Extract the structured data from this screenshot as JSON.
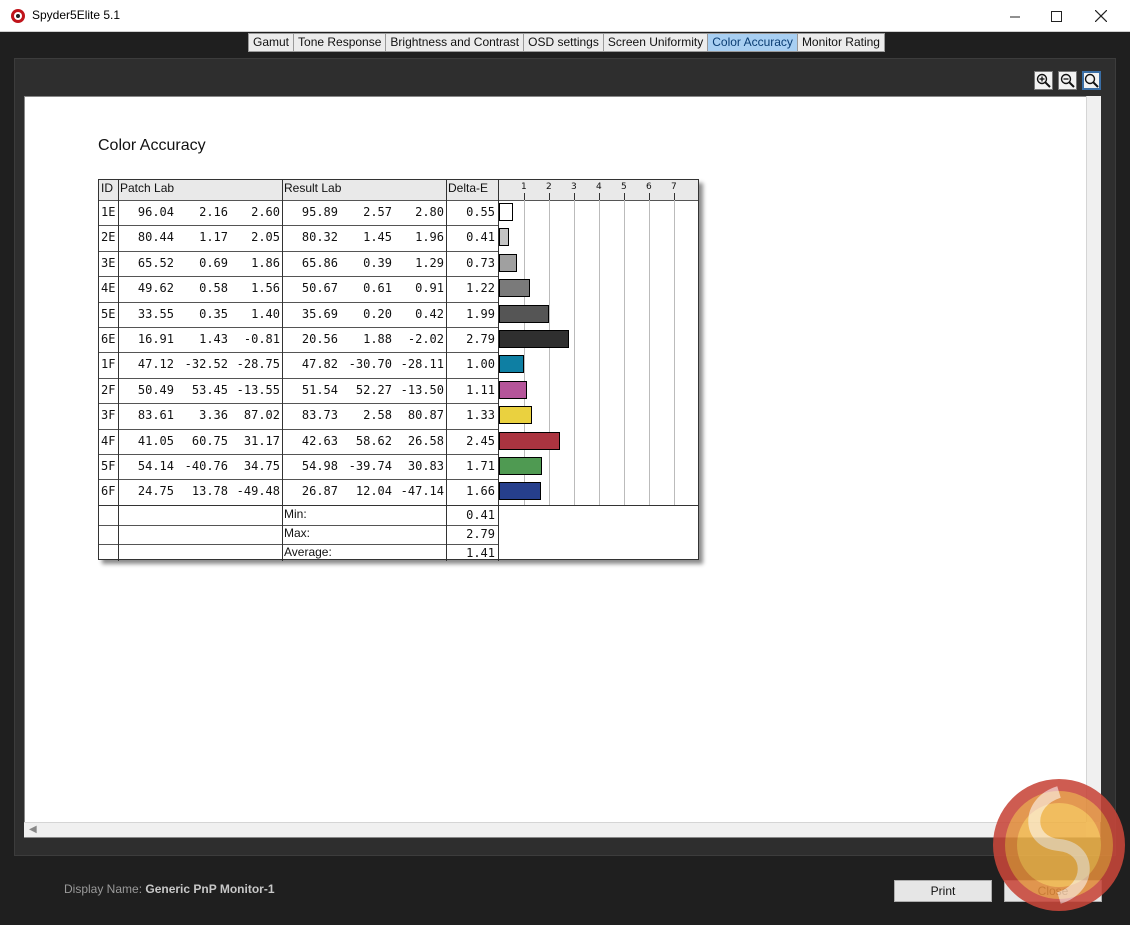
{
  "window": {
    "title": "Spyder5Elite 5.1"
  },
  "tabs": [
    {
      "label": "Gamut",
      "active": false
    },
    {
      "label": "Tone Response",
      "active": false
    },
    {
      "label": "Brightness and Contrast",
      "active": false
    },
    {
      "label": "OSD settings",
      "active": false
    },
    {
      "label": "Screen Uniformity",
      "active": false
    },
    {
      "label": "Color Accuracy",
      "active": true
    },
    {
      "label": "Monitor Rating",
      "active": false
    }
  ],
  "zoom_tools": [
    "zoom-in-icon",
    "zoom-out-icon",
    "zoom-fit-icon"
  ],
  "report": {
    "title": "Color Accuracy",
    "headers": {
      "id": "ID",
      "patch": "Patch Lab",
      "result": "Result Lab",
      "delta": "Delta-E"
    },
    "axis_ticks": [
      "1",
      "2",
      "3",
      "4",
      "5",
      "6",
      "7"
    ],
    "rows": [
      {
        "id": "1E",
        "patch": [
          "96.04",
          "2.16",
          "2.60"
        ],
        "result": [
          "95.89",
          "2.57",
          "2.80"
        ],
        "delta": "0.55",
        "value": 0.55,
        "color": "#ffffff"
      },
      {
        "id": "2E",
        "patch": [
          "80.44",
          "1.17",
          "2.05"
        ],
        "result": [
          "80.32",
          "1.45",
          "1.96"
        ],
        "delta": "0.41",
        "value": 0.41,
        "color": "#c4c4c4"
      },
      {
        "id": "3E",
        "patch": [
          "65.52",
          "0.69",
          "1.86"
        ],
        "result": [
          "65.86",
          "0.39",
          "1.29"
        ],
        "delta": "0.73",
        "value": 0.73,
        "color": "#a0a0a0"
      },
      {
        "id": "4E",
        "patch": [
          "49.62",
          "0.58",
          "1.56"
        ],
        "result": [
          "50.67",
          "0.61",
          "0.91"
        ],
        "delta": "1.22",
        "value": 1.22,
        "color": "#7a7a7a"
      },
      {
        "id": "5E",
        "patch": [
          "33.55",
          "0.35",
          "1.40"
        ],
        "result": [
          "35.69",
          "0.20",
          "0.42"
        ],
        "delta": "1.99",
        "value": 1.99,
        "color": "#555555"
      },
      {
        "id": "6E",
        "patch": [
          "16.91",
          "1.43",
          "-0.81"
        ],
        "result": [
          "20.56",
          "1.88",
          "-2.02"
        ],
        "delta": "2.79",
        "value": 2.79,
        "color": "#2f2f2f"
      },
      {
        "id": "1F",
        "patch": [
          "47.12",
          "-32.52",
          "-28.75"
        ],
        "result": [
          "47.82",
          "-30.70",
          "-28.11"
        ],
        "delta": "1.00",
        "value": 1.0,
        "color": "#0e7fa3"
      },
      {
        "id": "2F",
        "patch": [
          "50.49",
          "53.45",
          "-13.55"
        ],
        "result": [
          "51.54",
          "52.27",
          "-13.50"
        ],
        "delta": "1.11",
        "value": 1.11,
        "color": "#b5559a"
      },
      {
        "id": "3F",
        "patch": [
          "83.61",
          "3.36",
          "87.02"
        ],
        "result": [
          "83.73",
          "2.58",
          "80.87"
        ],
        "delta": "1.33",
        "value": 1.33,
        "color": "#ead13f"
      },
      {
        "id": "4F",
        "patch": [
          "41.05",
          "60.75",
          "31.17"
        ],
        "result": [
          "42.63",
          "58.62",
          "26.58"
        ],
        "delta": "2.45",
        "value": 2.45,
        "color": "#ab3440"
      },
      {
        "id": "5F",
        "patch": [
          "54.14",
          "-40.76",
          "34.75"
        ],
        "result": [
          "54.98",
          "-39.74",
          "30.83"
        ],
        "delta": "1.71",
        "value": 1.71,
        "color": "#4f9a52"
      },
      {
        "id": "6F",
        "patch": [
          "24.75",
          "13.78",
          "-49.48"
        ],
        "result": [
          "26.87",
          "12.04",
          "-47.14"
        ],
        "delta": "1.66",
        "value": 1.66,
        "color": "#263f8c"
      }
    ],
    "summary": [
      {
        "label": "Min:",
        "value": "0.41"
      },
      {
        "label": "Max:",
        "value": "2.79"
      },
      {
        "label": "Average:",
        "value": "1.41"
      }
    ]
  },
  "footer": {
    "display_name_label": "Display Name:",
    "display_name_value": "Generic PnP Monitor-1",
    "print_label": "Print",
    "close_label": "Close"
  }
}
